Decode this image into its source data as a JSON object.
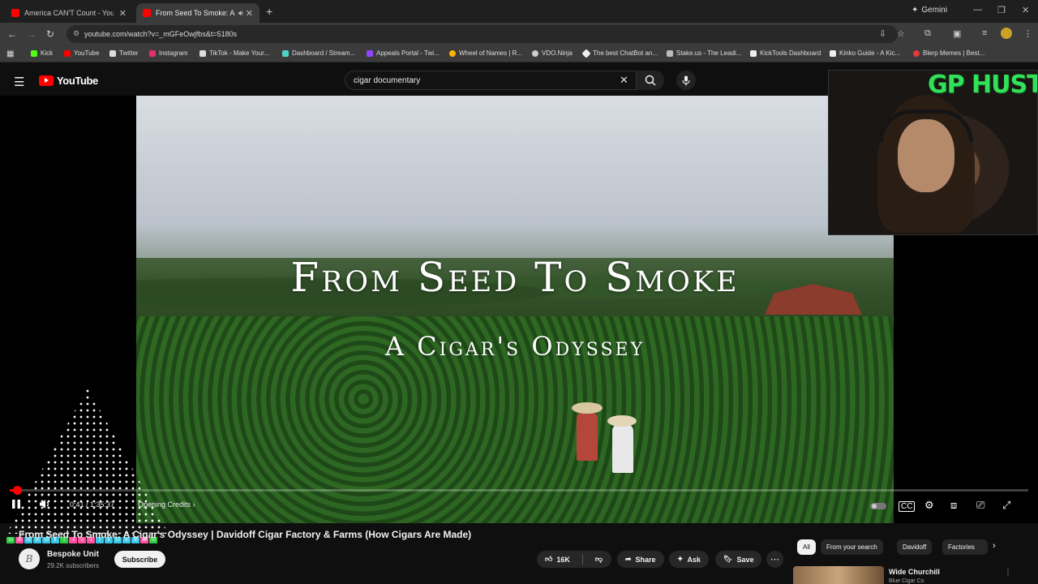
{
  "browser": {
    "tabs": [
      {
        "title": "America CAN'T Count - YouTub",
        "active": false
      },
      {
        "title": "From Seed To Smoke: A Cig",
        "active": true
      }
    ],
    "gemini_label": "Gemini",
    "url": "youtube.com/watch?v=_mGFeOwjfbs&t=5180s"
  },
  "bookmarks": [
    {
      "label": "Kick",
      "color": "#53fc18"
    },
    {
      "label": "YouTube",
      "color": "#ff0000"
    },
    {
      "label": "Twitter",
      "color": "#ffffff"
    },
    {
      "label": "Instagram",
      "color": "#e1306c"
    },
    {
      "label": "TikTok - Make Your...",
      "color": "#ffffff"
    },
    {
      "label": "Dashboard / Stream...",
      "color": "#4fd1c5"
    },
    {
      "label": "Appeals Portal - Twi...",
      "color": "#9146ff"
    },
    {
      "label": "Wheel of Names | R...",
      "color": "#ffb300"
    },
    {
      "label": "VDO.Ninja",
      "color": "#cccccc"
    },
    {
      "label": "The best ChatBot an...",
      "color": "#ffffff"
    },
    {
      "label": "Stake.us - The Leadi...",
      "color": "#cccccc"
    },
    {
      "label": "KickTools Dashboard",
      "color": "#ffffff"
    },
    {
      "label": "Kinko Guide - A Kic...",
      "color": "#ffffff"
    },
    {
      "label": "Blerp Memes | Best...",
      "color": "#e53935"
    }
  ],
  "youtube": {
    "logo_text": "YouTube",
    "search_query": "cigar documentary"
  },
  "video": {
    "overlay_title": "From Seed To Smoke",
    "overlay_subtitle": "A Cigar's Odyssey",
    "current_time": "0:41 / 1:35:37",
    "chapter": "Opening Credits",
    "progress_fraction": 0.007,
    "title": "From Seed To Smoke: A Cigar's Odyssey | Davidoff Cigar Factory & Farms (How Cigars Are Made)"
  },
  "webcam": {
    "overlay_text": "GP HUSTLA"
  },
  "visualizer_bar": [
    {
      "t": "10",
      "c": "#2ecc40"
    },
    {
      "t": "20",
      "c": "#ff4fa0"
    },
    {
      "t": "35",
      "c": "#39c6e6"
    },
    {
      "t": "35",
      "c": "#39c6e6"
    },
    {
      "t": "10",
      "c": "#39c6e6"
    },
    {
      "t": "8",
      "c": "#39c6e6"
    },
    {
      "t": "1",
      "c": "#2ecc40"
    },
    {
      "t": "-1",
      "c": "#ff4fa0"
    },
    {
      "t": "-2",
      "c": "#ff4fa0"
    },
    {
      "t": "-1",
      "c": "#ff4fa0"
    },
    {
      "t": "1",
      "c": "#39c6e6"
    },
    {
      "t": "8",
      "c": "#39c6e6"
    },
    {
      "t": "10",
      "c": "#39c6e6"
    },
    {
      "t": "35",
      "c": "#39c6e6"
    },
    {
      "t": "35",
      "c": "#39c6e6"
    },
    {
      "t": "20",
      "c": "#ff4fa0"
    },
    {
      "t": "10",
      "c": "#2ecc40"
    }
  ],
  "channel": {
    "name": "Bespoke Unit",
    "subscribers": "29.2K subscribers",
    "subscribe_label": "Subscribe",
    "avatar_letter": "B"
  },
  "actions": {
    "likes": "16K",
    "share": "Share",
    "ask": "Ask",
    "save": "Save"
  },
  "chips": [
    "All",
    "From your search",
    "Davidoff",
    "Factories"
  ],
  "recommendation": {
    "title": "Wide Churchill",
    "channel": "Blue Cigar Co"
  }
}
